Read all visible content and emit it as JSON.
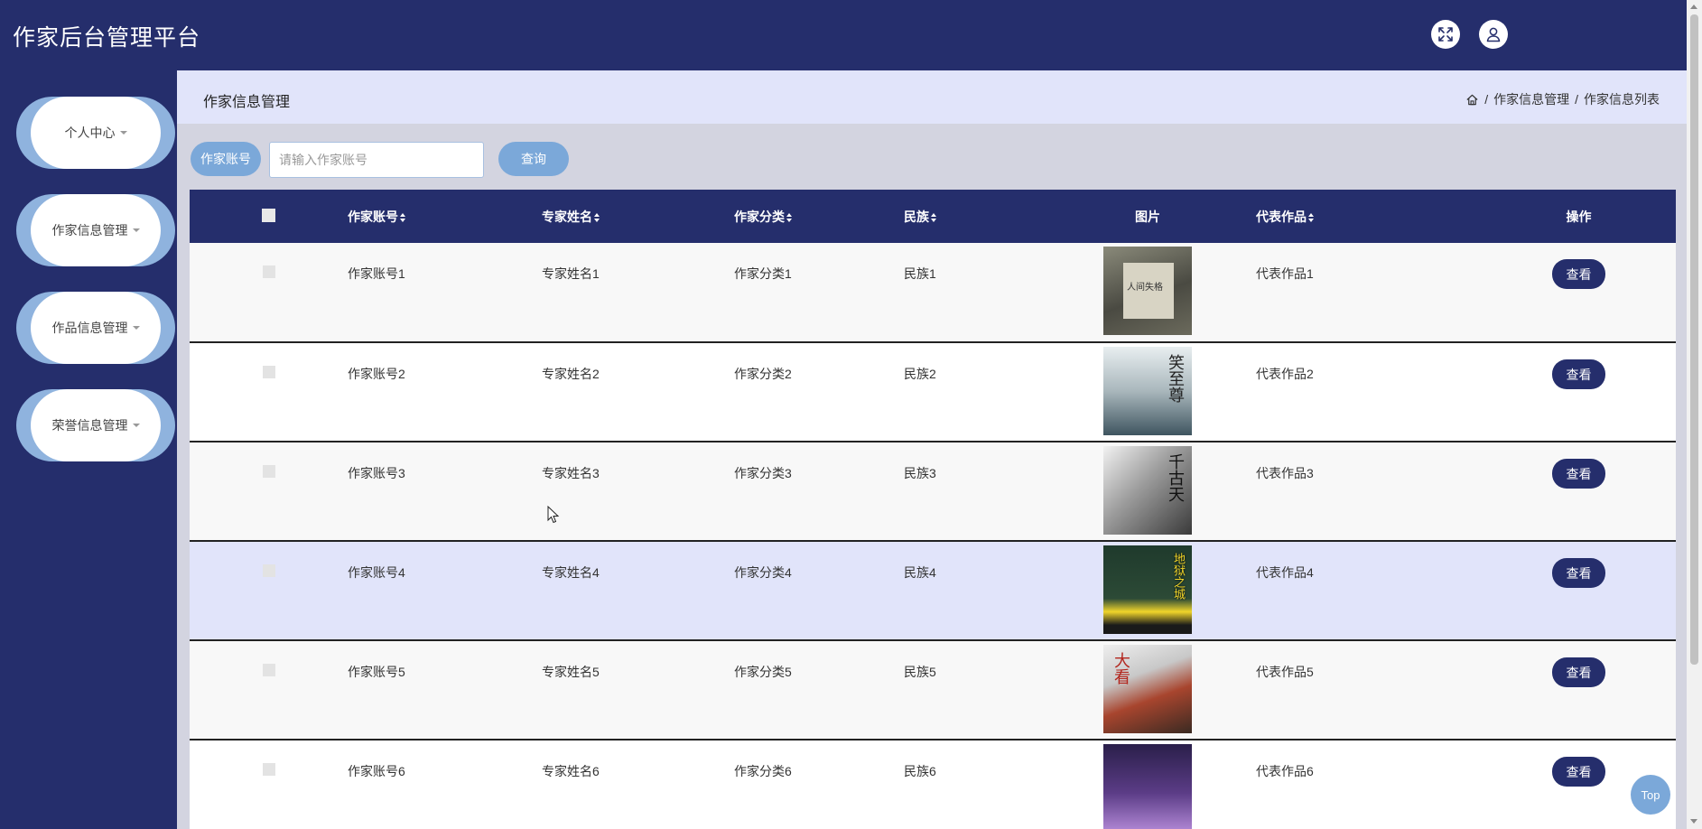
{
  "header": {
    "title": "作家后台管理平台",
    "fullscreen_icon": "fullscreen-icon",
    "user_icon": "user-icon"
  },
  "sidebar": {
    "items": [
      {
        "label": "个人中心"
      },
      {
        "label": "作家信息管理"
      },
      {
        "label": "作品信息管理"
      },
      {
        "label": "荣誉信息管理"
      }
    ]
  },
  "breadcrumb_bar": {
    "heading": "作家信息管理",
    "home_icon": "home-icon",
    "crumbs": [
      "作家信息管理",
      "作家信息列表"
    ],
    "separator": "/"
  },
  "search": {
    "label": "作家账号",
    "placeholder": "请输入作家账号",
    "value": "",
    "button": "查询"
  },
  "table": {
    "columns": [
      "作家账号",
      "专家姓名",
      "作家分类",
      "民族",
      "图片",
      "代表作品",
      "操作"
    ],
    "rows": [
      {
        "account": "作家账号1",
        "name": "专家姓名1",
        "category": "作家分类1",
        "nation": "民族1",
        "work": "代表作品1",
        "action": "查看",
        "cover_text": "人间失格"
      },
      {
        "account": "作家账号2",
        "name": "专家姓名2",
        "category": "作家分类2",
        "nation": "民族2",
        "work": "代表作品2",
        "action": "查看",
        "cover_text": "笑至尊"
      },
      {
        "account": "作家账号3",
        "name": "专家姓名3",
        "category": "作家分类3",
        "nation": "民族3",
        "work": "代表作品3",
        "action": "查看",
        "cover_text": "千古天"
      },
      {
        "account": "作家账号4",
        "name": "专家姓名4",
        "category": "作家分类4",
        "nation": "民族4",
        "work": "代表作品4",
        "action": "查看",
        "cover_text": "地狱之城"
      },
      {
        "account": "作家账号5",
        "name": "专家姓名5",
        "category": "作家分类5",
        "nation": "民族5",
        "work": "代表作品5",
        "action": "查看",
        "cover_text": "大看"
      },
      {
        "account": "作家账号6",
        "name": "专家姓名6",
        "category": "作家分类6",
        "nation": "民族6",
        "work": "代表作品6",
        "action": "查看",
        "cover_text": ""
      }
    ]
  },
  "back_to_top": "Top",
  "colors": {
    "primary": "#252e6c",
    "accent": "#7ba8d9",
    "breadcrumb_bg": "#e1e4fa",
    "content_bg": "#d3d4e0"
  }
}
